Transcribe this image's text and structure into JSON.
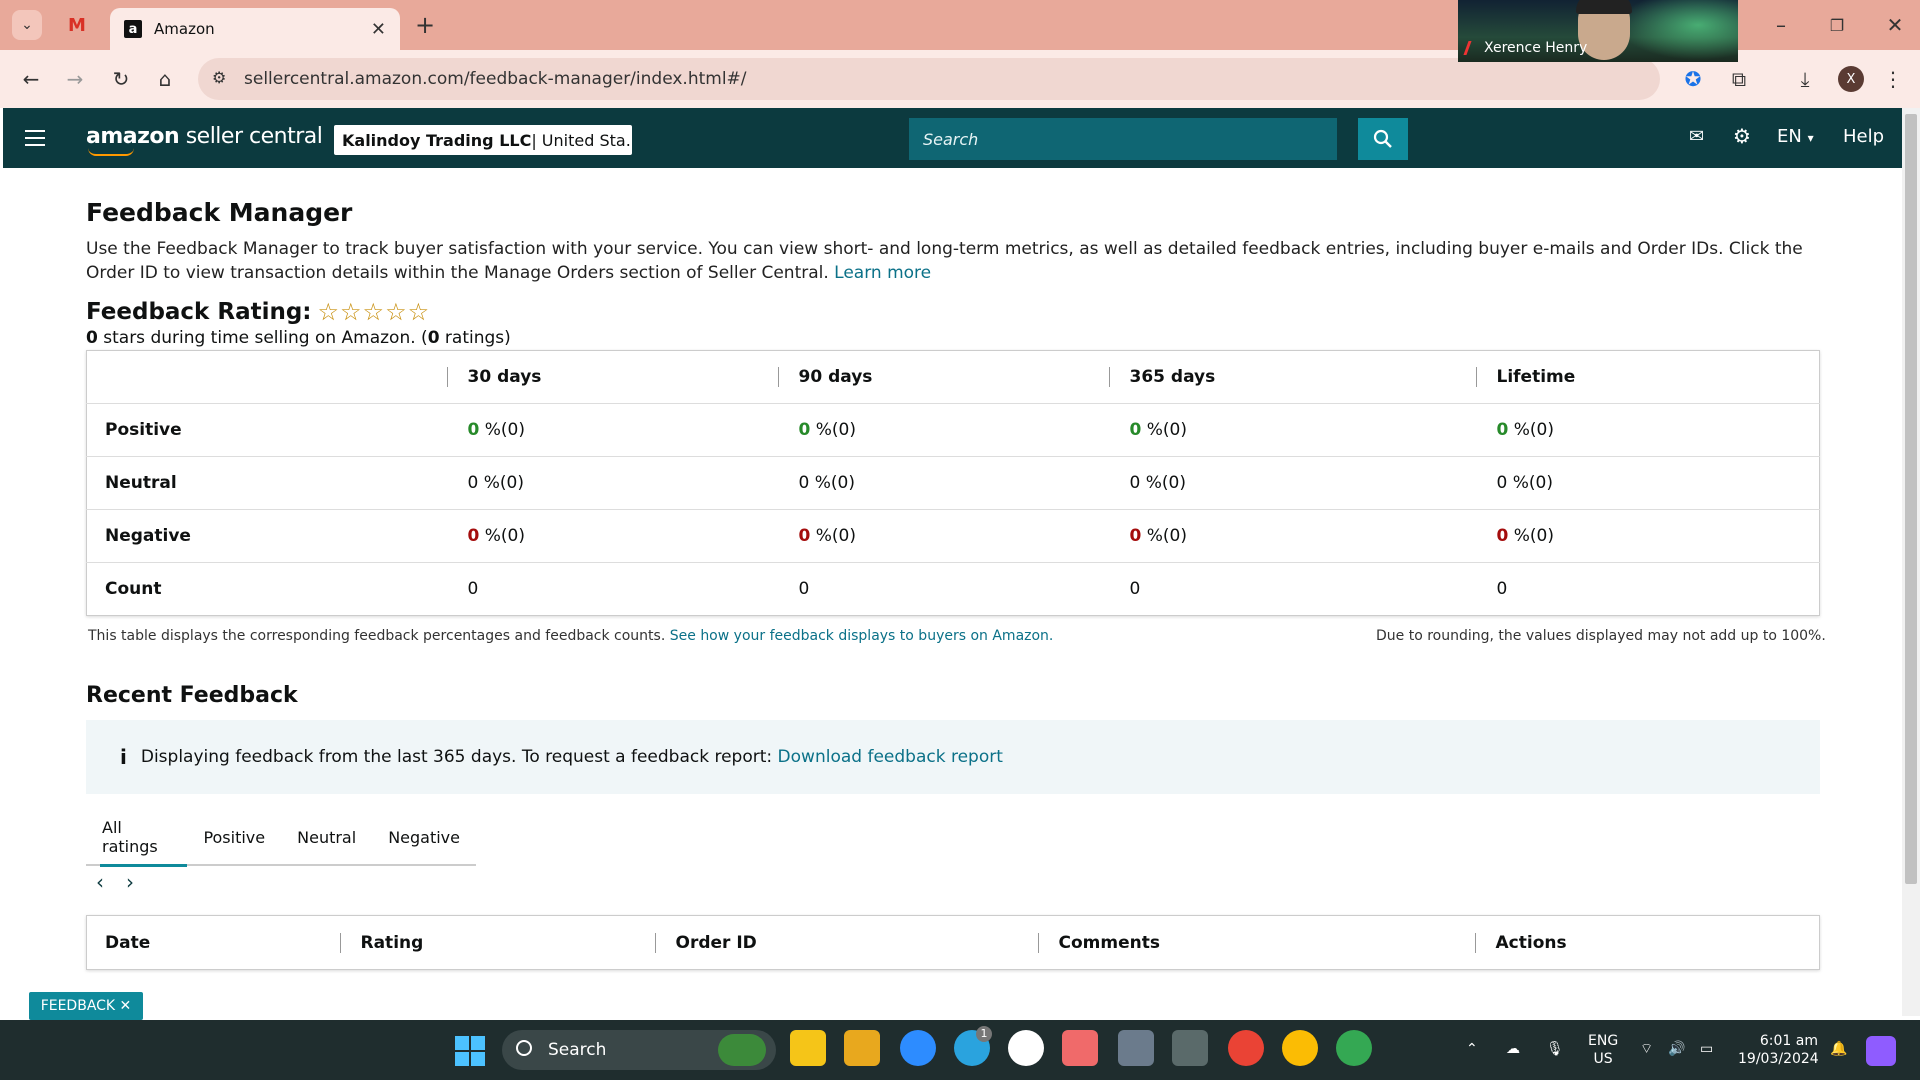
{
  "browser": {
    "tab_title": "Amazon",
    "url": "sellercentral.amazon.com/feedback-manager/index.html#/",
    "profile_initial": "X"
  },
  "video": {
    "participant": "Xerence Henry"
  },
  "nav": {
    "logo_bold": "amazon",
    "logo_rest": " seller central",
    "store_bold": "Kalindoy Trading LLC",
    "store_rest": " | United Sta...",
    "search_placeholder": "Search",
    "language": "EN",
    "help": "Help"
  },
  "page": {
    "title": "Feedback Manager",
    "description": "Use the Feedback Manager to track buyer satisfaction with your service. You can view short- and long-term metrics, as well as detailed feedback entries, including buyer e-mails and Order IDs. Click the Order ID to view transaction details within the Manage Orders section of Seller Central.",
    "learn_more": "Learn more",
    "rating_label": "Feedback Rating:",
    "stars": "☆☆☆☆☆",
    "stars_count": "0",
    "stars_text": " stars during time selling on Amazon. (",
    "ratings_count": "0",
    "ratings_text": " ratings)"
  },
  "table": {
    "headers": [
      "30 days",
      "90 days",
      "365 days",
      "Lifetime"
    ],
    "rows": [
      {
        "label": "Positive",
        "cells": [
          [
            "0",
            "%(0)"
          ],
          [
            "0",
            "%(0)"
          ],
          [
            "0",
            "%(0)"
          ],
          [
            "0",
            "%(0)"
          ]
        ]
      },
      {
        "label": "Neutral",
        "cells": [
          [
            "0",
            "%(0)"
          ],
          [
            "0",
            "%(0)"
          ],
          [
            "0",
            "%(0)"
          ],
          [
            "0",
            "%(0)"
          ]
        ]
      },
      {
        "label": "Negative",
        "cells": [
          [
            "0",
            "%(0)"
          ],
          [
            "0",
            "%(0)"
          ],
          [
            "0",
            "%(0)"
          ],
          [
            "0",
            "%(0)"
          ]
        ]
      },
      {
        "label": "Count",
        "cells": [
          "0",
          "0",
          "0",
          "0"
        ]
      }
    ],
    "note": "This table displays the corresponding feedback percentages and feedback counts.",
    "note_link": "See how your feedback displays to buyers on Amazon.",
    "rounding_note": "Due to rounding, the values displayed may not add up to 100%."
  },
  "recent": {
    "title": "Recent Feedback",
    "info": "Displaying feedback from the last 365 days. To request a feedback report:",
    "info_link": "Download feedback report",
    "tabs": [
      "All ratings",
      "Positive",
      "Neutral",
      "Negative"
    ],
    "columns": [
      "Date",
      "Rating",
      "Order ID",
      "Comments",
      "Actions"
    ]
  },
  "feedback_button": "FEEDBACK ✕",
  "taskbar": {
    "search": "Search",
    "lang1": "ENG",
    "lang2": "US",
    "time": "6:01 am",
    "date": "19/03/2024",
    "telegram_badge": "1"
  },
  "colors": {
    "nav_bg": "#0c3a3f",
    "accent": "#0f8a9b",
    "positive": "#278a2a",
    "negative": "#a40d0d",
    "link": "#0b7188"
  }
}
